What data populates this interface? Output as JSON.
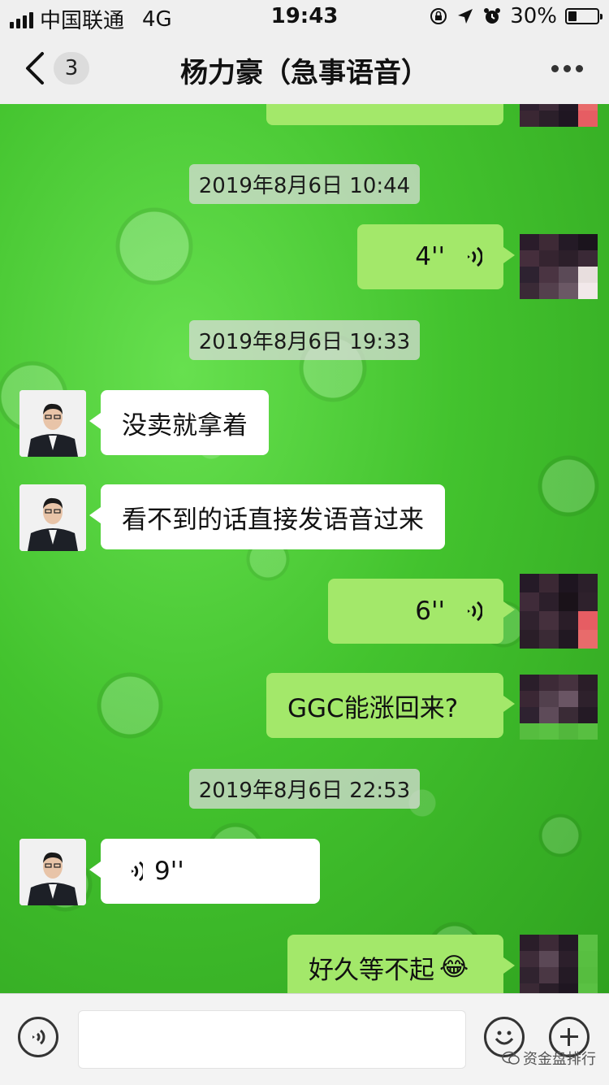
{
  "status_bar": {
    "carrier": "中国联通",
    "network": "4G",
    "time": "19:43",
    "battery": "30%",
    "battery_level": 0.3
  },
  "header": {
    "unread_count": "3",
    "title": "杨力豪（急事语音）"
  },
  "messages": [
    {
      "type": "timestamp",
      "text": "2019年8月6日 10:44"
    },
    {
      "type": "voice",
      "side": "out",
      "duration": "4''"
    },
    {
      "type": "timestamp",
      "text": "2019年8月6日 19:33"
    },
    {
      "type": "text",
      "side": "in",
      "text": "没卖就拿着"
    },
    {
      "type": "text",
      "side": "in",
      "text": "看不到的话直接发语音过来"
    },
    {
      "type": "voice",
      "side": "out",
      "duration": "6''"
    },
    {
      "type": "text",
      "side": "out",
      "text": "GGC能涨回来?"
    },
    {
      "type": "timestamp",
      "text": "2019年8月6日 22:53"
    },
    {
      "type": "voice",
      "side": "in",
      "duration": "9''"
    },
    {
      "type": "text",
      "side": "out",
      "text": "好久等不起",
      "emoji": "😂"
    }
  ],
  "input_bar": {
    "text_value": "",
    "watermark": "资金盘排行"
  },
  "colors": {
    "outgoing_bubble": "#a3e86a",
    "incoming_bubble": "#ffffff",
    "wallpaper": "#4fcf3a"
  },
  "icons": [
    "signal-icon",
    "lock-rotation-icon",
    "location-arrow-icon",
    "alarm-icon",
    "battery-icon",
    "back-chevron-icon",
    "more-dots-icon",
    "voice-wave-icon",
    "voice-mode-icon",
    "emoji-icon",
    "plus-icon",
    "wechat-logo-icon"
  ]
}
